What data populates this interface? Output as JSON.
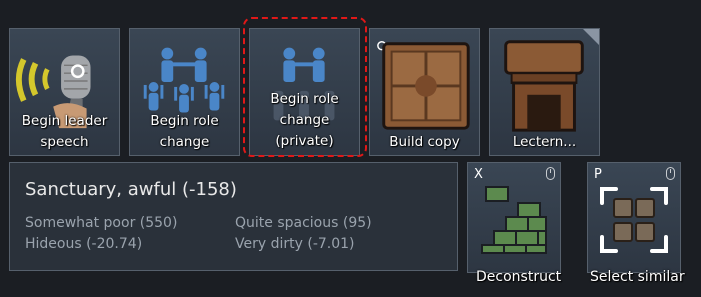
{
  "gizmos": [
    {
      "label": "Begin leader speech",
      "line1": "Begin leader",
      "line2": "speech",
      "icon": "microphone-icon"
    },
    {
      "label": "Begin role change",
      "line1": "Begin role",
      "line2": "change",
      "icon": "people-group-icon"
    },
    {
      "label": "Begin role change (private)",
      "line1": "Begin role",
      "line2": "change",
      "line3": "(private)",
      "icon": "people-group-private-icon",
      "selected": true
    },
    {
      "label": "Build copy",
      "line1": "Build copy",
      "icon": "wooden-crate-icon"
    },
    {
      "label": "Lectern...",
      "line1": "Lectern...",
      "icon": "lectern-icon"
    }
  ],
  "room_info": {
    "title": "Sanctuary, awful (-158)",
    "stats": [
      {
        "text": "Somewhat poor (550)"
      },
      {
        "text": "Quite spacious (95)"
      },
      {
        "text": "Hideous (-20.74)"
      },
      {
        "text": "Very dirty (-7.01)"
      }
    ]
  },
  "commands": [
    {
      "key": "X",
      "label": "Deconstruct",
      "icon": "deconstruct-bricks-icon"
    },
    {
      "key": "P",
      "label": "Select similar",
      "icon": "select-similar-icon"
    }
  ],
  "colors": {
    "selection_outline": "#e01818",
    "panel_bg": "#2a313a",
    "button_bg": "#34404d"
  }
}
